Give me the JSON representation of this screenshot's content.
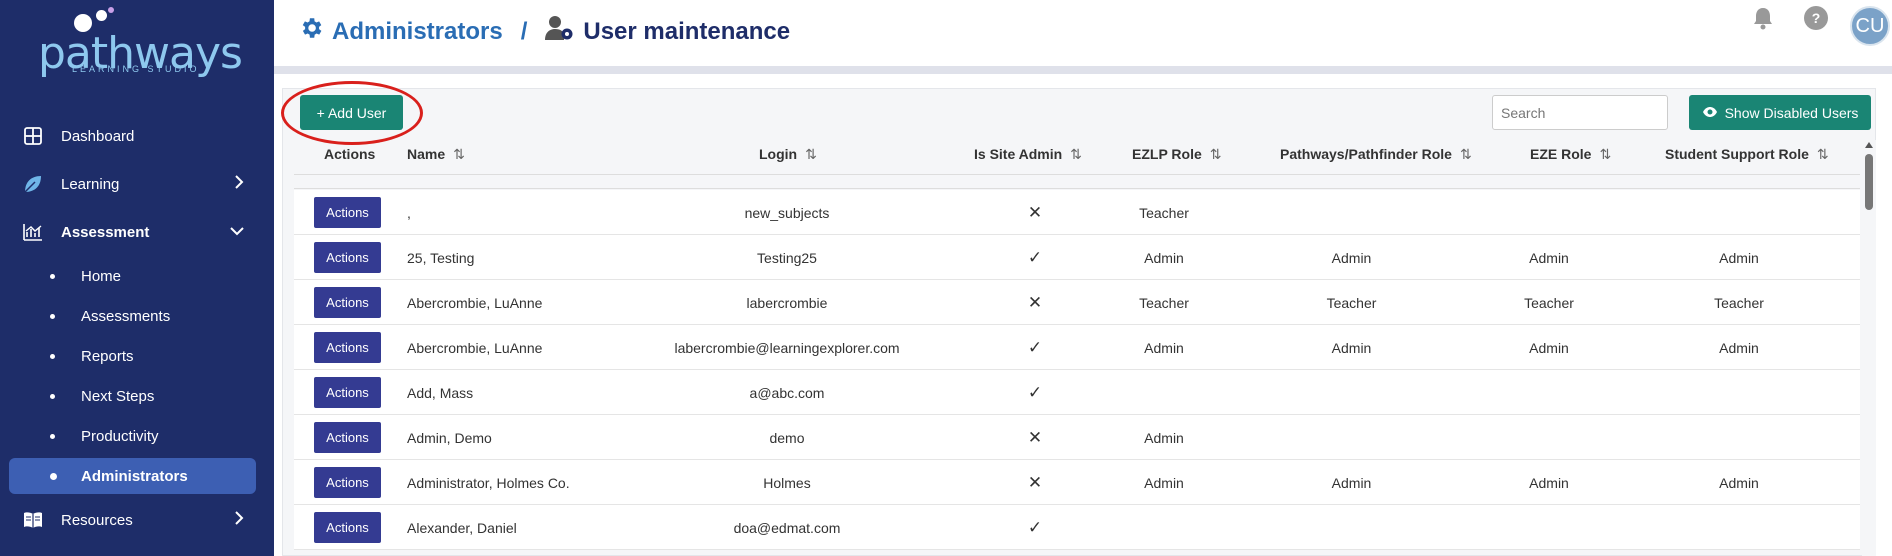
{
  "brand": {
    "name": "pathways",
    "tagline": "LEARNING STUDIO"
  },
  "sidebar": {
    "items": [
      {
        "label": "Dashboard",
        "icon": "grid-icon"
      },
      {
        "label": "Learning",
        "icon": "leaf-icon"
      },
      {
        "label": "Assessment",
        "icon": "chart-icon"
      },
      {
        "label": "Resources",
        "icon": "book-icon"
      }
    ],
    "subitems": [
      {
        "label": "Home"
      },
      {
        "label": "Assessments"
      },
      {
        "label": "Reports"
      },
      {
        "label": "Next Steps"
      },
      {
        "label": "Productivity"
      },
      {
        "label": "Administrators",
        "active": true
      }
    ]
  },
  "header": {
    "crumb_parent": "Administrators",
    "crumb_sep": "/",
    "crumb_current": "User maintenance",
    "help_label": "?",
    "avatar_initials": "CU"
  },
  "toolbar": {
    "add_user_label": "+ Add User",
    "search_placeholder": "Search",
    "show_disabled_label": "Show Disabled Users"
  },
  "table": {
    "columns": [
      "Actions",
      "Name",
      "Login",
      "Is Site Admin",
      "EZLP Role",
      "Pathways/Pathfinder Role",
      "EZE Role",
      "Student Support Role"
    ],
    "action_label": "Actions",
    "rows": [
      {
        "name": ",",
        "login": "new_subjects",
        "site_admin": "✕",
        "ezlp": "Teacher",
        "pathways": "",
        "eze": "",
        "support": ""
      },
      {
        "name": "25, Testing",
        "login": "Testing25",
        "site_admin": "✓",
        "ezlp": "Admin",
        "pathways": "Admin",
        "eze": "Admin",
        "support": "Admin"
      },
      {
        "name": "Abercrombie, LuAnne",
        "login": "labercrombie",
        "site_admin": "✕",
        "ezlp": "Teacher",
        "pathways": "Teacher",
        "eze": "Teacher",
        "support": "Teacher"
      },
      {
        "name": "Abercrombie, LuAnne",
        "login": "labercrombie@learningexplorer.com",
        "site_admin": "✓",
        "ezlp": "Admin",
        "pathways": "Admin",
        "eze": "Admin",
        "support": "Admin"
      },
      {
        "name": "Add, Mass",
        "login": "a@abc.com",
        "site_admin": "✓",
        "ezlp": "",
        "pathways": "",
        "eze": "",
        "support": ""
      },
      {
        "name": "Admin, Demo",
        "login": "demo",
        "site_admin": "✕",
        "ezlp": "Admin",
        "pathways": "",
        "eze": "",
        "support": ""
      },
      {
        "name": "Administrator, Holmes Co.",
        "login": "Holmes",
        "site_admin": "✕",
        "ezlp": "Admin",
        "pathways": "Admin",
        "eze": "Admin",
        "support": "Admin"
      },
      {
        "name": "Alexander, Daniel",
        "login": "doa@edmat.com",
        "site_admin": "✓",
        "ezlp": "",
        "pathways": "",
        "eze": "",
        "support": ""
      }
    ]
  },
  "colors": {
    "sidebar": "#1e2d69",
    "accent": "#1a8574",
    "actions": "#343b92",
    "crumb": "#2a6db4",
    "highlight": "#d9201c"
  }
}
